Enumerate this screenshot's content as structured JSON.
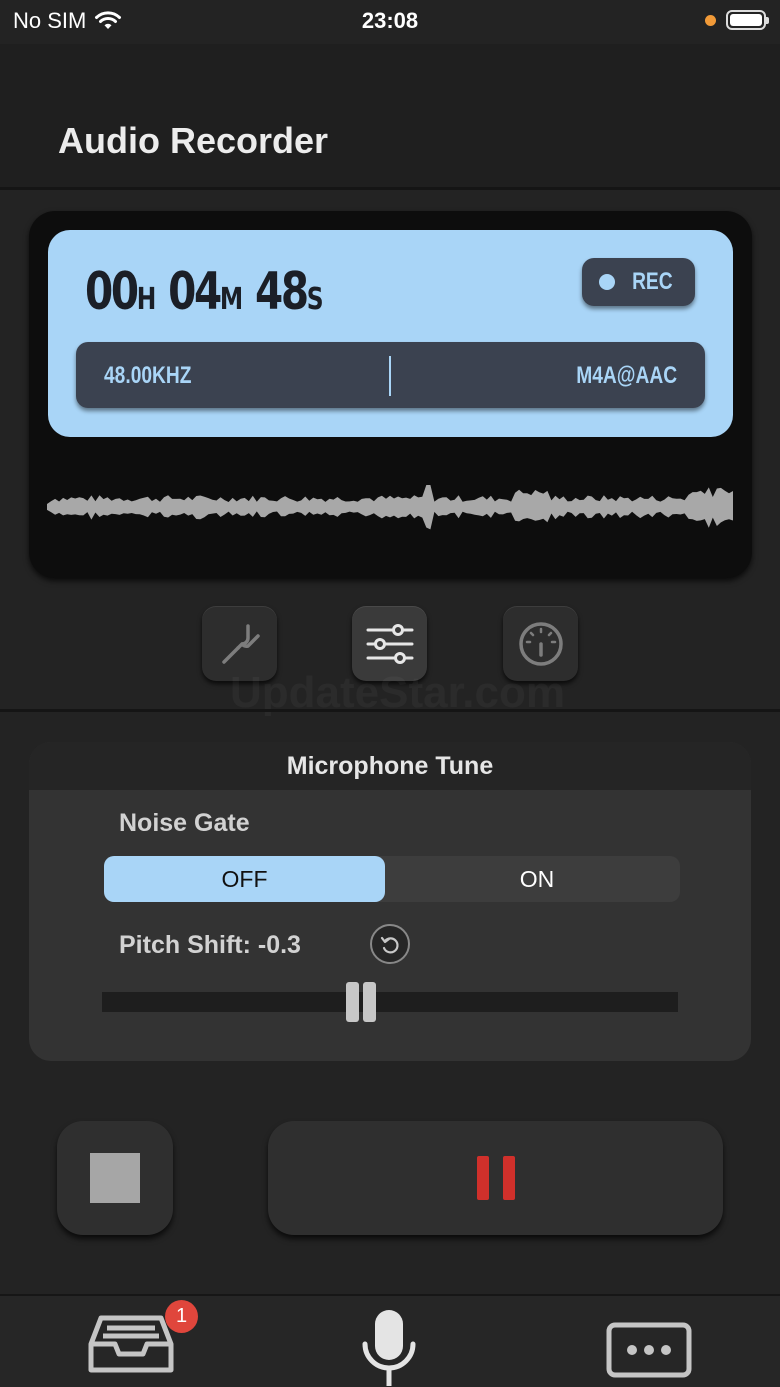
{
  "status": {
    "carrier": "No SIM",
    "time": "23:08"
  },
  "header": {
    "title": "Audio Recorder"
  },
  "recorder": {
    "hours": "00",
    "hours_unit": "H",
    "minutes": "04",
    "minutes_unit": "M",
    "seconds": "48",
    "seconds_unit": "S",
    "rec_label": "REC",
    "sample_rate": "48.00KHZ",
    "format": "M4A@AAC"
  },
  "tools": [
    "tuning-fork-icon",
    "equalizer-sliders-icon",
    "gauge-icon"
  ],
  "watermark": "UpdateStar.com",
  "tune": {
    "title": "Microphone Tune",
    "noise_gate_label": "Noise Gate",
    "noise_gate_options": {
      "off": "OFF",
      "on": "ON"
    },
    "noise_gate_selected": "OFF",
    "pitch_label": "Pitch Shift: -0.3",
    "pitch_slider_fraction": 0.45
  },
  "controls": {
    "stop": "stop-icon",
    "pause": "pause-icon"
  },
  "tabbar": {
    "inbox_badge": "1",
    "items": [
      "inbox-icon",
      "microphone-icon",
      "more-icon"
    ]
  },
  "colors": {
    "accent": "#a9d5f7",
    "pause": "#d0302b",
    "badge": "#e0463c"
  }
}
